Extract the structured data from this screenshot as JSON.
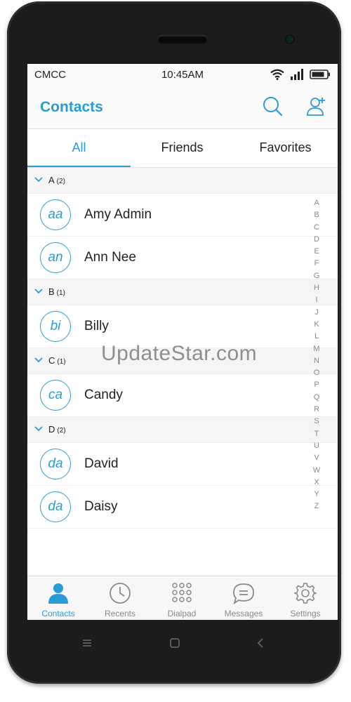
{
  "status_bar": {
    "carrier": "CMCC",
    "time": "10:45AM"
  },
  "header": {
    "title": "Contacts",
    "search_icon": "search-icon",
    "add_contact_icon": "add-contact-icon"
  },
  "tabs": [
    {
      "label": "All",
      "active": true
    },
    {
      "label": "Friends",
      "active": false
    },
    {
      "label": "Favorites",
      "active": false
    }
  ],
  "sections": [
    {
      "letter": "A",
      "count": "(2)",
      "contacts": [
        {
          "initials": "aa",
          "name": "Amy Admin"
        },
        {
          "initials": "an",
          "name": "Ann Nee"
        }
      ]
    },
    {
      "letter": "B",
      "count": "(1)",
      "contacts": [
        {
          "initials": "bi",
          "name": "Billy"
        }
      ]
    },
    {
      "letter": "C",
      "count": "(1)",
      "contacts": [
        {
          "initials": "ca",
          "name": "Candy"
        }
      ]
    },
    {
      "letter": "D",
      "count": "(2)",
      "contacts": [
        {
          "initials": "da",
          "name": "David"
        },
        {
          "initials": "da",
          "name": "Daisy"
        }
      ]
    }
  ],
  "alphabet_index": [
    "A",
    "B",
    "C",
    "D",
    "E",
    "F",
    "G",
    "H",
    "I",
    "J",
    "K",
    "L",
    "M",
    "N",
    "O",
    "P",
    "Q",
    "R",
    "S",
    "T",
    "U",
    "V",
    "W",
    "X",
    "Y",
    "Z"
  ],
  "watermark": "UpdateStar.com",
  "bottom_nav": [
    {
      "label": "Contacts",
      "icon": "person-icon",
      "active": true
    },
    {
      "label": "Recents",
      "icon": "clock-icon",
      "active": false
    },
    {
      "label": "Dialpad",
      "icon": "dialpad-icon",
      "active": false
    },
    {
      "label": "Messages",
      "icon": "message-icon",
      "active": false
    },
    {
      "label": "Settings",
      "icon": "gear-icon",
      "active": false
    }
  ],
  "colors": {
    "accent": "#2b9bd6",
    "phone_body": "#1c1c1d",
    "text": "#222222",
    "muted": "#8a8a8a"
  }
}
